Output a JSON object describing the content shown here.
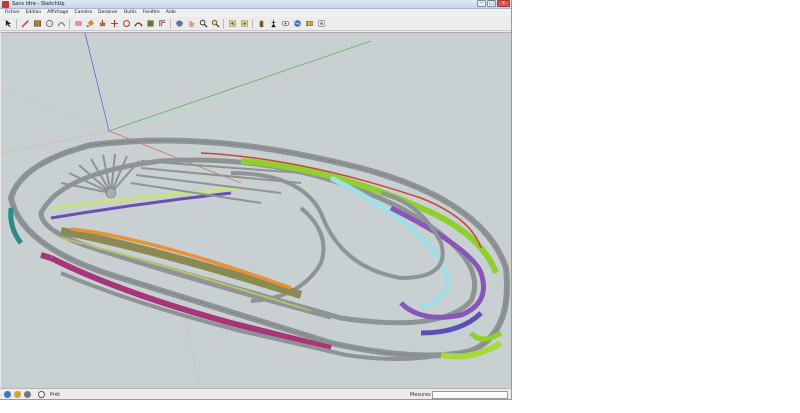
{
  "window": {
    "title": "Sans titre - SketchUp",
    "controls": {
      "minimize": "–",
      "maximize": "□",
      "close": "x"
    }
  },
  "menu": {
    "items": [
      "Fichier",
      "Edition",
      "Affichage",
      "Caméra",
      "Dessiner",
      "Outils",
      "Fenêtre",
      "Aide"
    ]
  },
  "toolbar": {
    "tools": [
      "select-arrow-icon",
      "pencil-icon",
      "rectangle-icon",
      "circle-icon",
      "arc-icon",
      "eraser-icon",
      "paint-bucket-icon",
      "push-pull-icon",
      "move-icon",
      "rotate-icon",
      "follow-me-icon",
      "scale-icon",
      "offset-icon",
      "tape-measure-icon",
      "orbit-icon",
      "pan-icon",
      "zoom-icon",
      "zoom-extents-icon",
      "previous-view-icon",
      "next-view-icon",
      "position-camera-icon",
      "walk-icon",
      "look-around-icon",
      "warehouse-icon",
      "components-icon",
      "extension-icon"
    ]
  },
  "status": {
    "text": "Prêt",
    "measure_label": "Mesures",
    "measure_value": ""
  },
  "colors": {
    "viewport_bg": "#c8d0d1",
    "track_gray": "#8e9395",
    "track_purple": "#8a55b8",
    "track_magenta": "#a8347a",
    "track_green": "#8fcf2e",
    "track_cyan": "#9fe0e8",
    "track_orange": "#e8913a",
    "track_olive": "#8a8a52",
    "track_red": "#c9463a",
    "track_lightgreen": "#c7e08c",
    "axis_green": "#3aa83a",
    "axis_blue": "#3a4fd9",
    "axis_red": "#d94a3a"
  }
}
